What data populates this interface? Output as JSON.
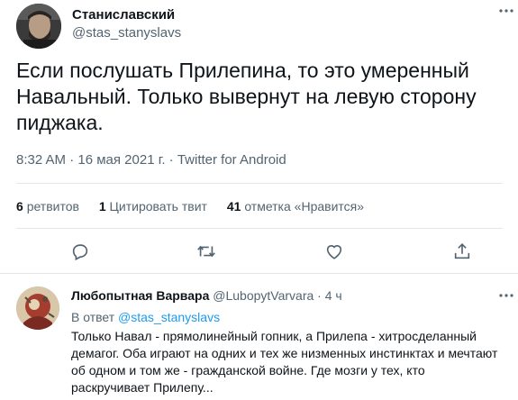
{
  "tweet": {
    "author": {
      "name": "Станиславский",
      "handle": "@stas_stanyslavs"
    },
    "more_icon": "more-dots-icon",
    "text": "Если послушать Прилепина, то это умеренный Навальный. Только вывернут на левую сторону пиджака.",
    "meta": "8:32 AM · 16 мая 2021 г. · Twitter for Android",
    "stats": {
      "retweets_count": "6",
      "retweets_label": "ретвитов",
      "quotes_count": "1",
      "quotes_label": "Цитировать твит",
      "likes_count": "41",
      "likes_label": "отметка «Нравится»"
    },
    "actions": [
      "reply-icon",
      "retweet-icon",
      "like-icon",
      "share-icon"
    ]
  },
  "reply": {
    "author": {
      "name": "Любопытная Варвара",
      "handle": "@LubopytVarvara",
      "time": "4 ч"
    },
    "reply_to_prefix": "В ответ",
    "reply_to_handle": "@stas_stanyslavs",
    "text": "Только Навал - прямолинейный гопник, а Прилепа - хитросделанный демагог. Оба играют на одних и тех же низменных инстинктах и мечтают об одном и том же - гражданской войне. Где мозги у тех, кто раскручивает Прилепу..."
  },
  "colors": {
    "text": "#0f1419",
    "secondary": "#536471",
    "link": "#1d9bf0",
    "divider": "#e1e8ed"
  }
}
